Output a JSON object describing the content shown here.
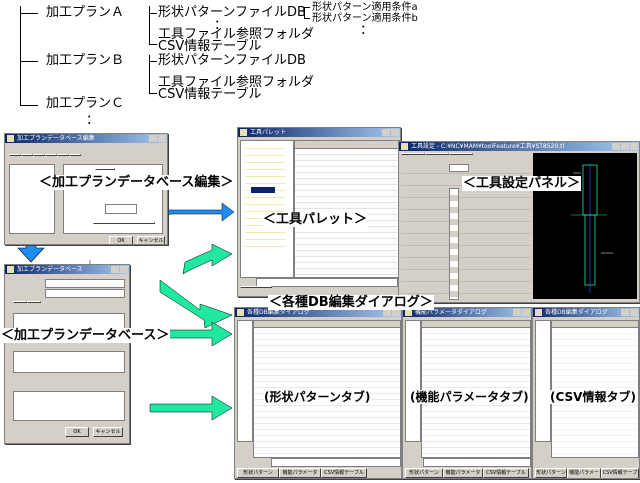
{
  "tree": {
    "plan_a": "加工プランＡ",
    "plan_b": "加工プランＢ",
    "plan_c": "加工プランＣ",
    "shape_db": "形状パターンファイルDB",
    "tool_folder": "工具ファイル参照フォルダ",
    "csv_table": "CSV情報テーブル",
    "cond_a": "形状パターン適用条件a",
    "cond_b": "形状パターン適用条件b",
    "ellipsis": "："
  },
  "callouts": {
    "plan_db_edit": "＜加工プランデータベース編集＞",
    "tool_settings": "＜工具設定パネル＞",
    "tool_palette": "＜工具パレット＞",
    "db_dialogs": "＜各種DB編集ダイアログ＞",
    "plan_db": "＜加工プランデータベース＞",
    "shape_tab": "(形状パターンタブ)",
    "func_tab": "(機能パラメータタブ)",
    "csv_tab": "(CSV情報タブ)"
  },
  "windows": {
    "plan_db_edit_title": "加工プランデータベース編集",
    "plan_db_title": "加工プランデータベース",
    "tool_palette_title": "工具パレット",
    "tool_settings_title": "工具設定 - C:¥NC¥MAM¥toolFeature¥工具¥ST8520.tl",
    "dialog1_title": "各種DB編集ダイアログ",
    "dialog2_title": "機能パラメータダイアログ",
    "dialog3_title": "各種DB編集ダイアログ",
    "ok": "OK",
    "cancel": "キャンセル"
  },
  "tabs": {
    "shape": "形状パターン",
    "func": "機能パラメータ",
    "csv": "CSV情報テーブル"
  },
  "colors": {
    "arrow_blue": "#1e8cf0",
    "arrow_green": "#20e8a0",
    "title_blue": "#0a246a"
  }
}
